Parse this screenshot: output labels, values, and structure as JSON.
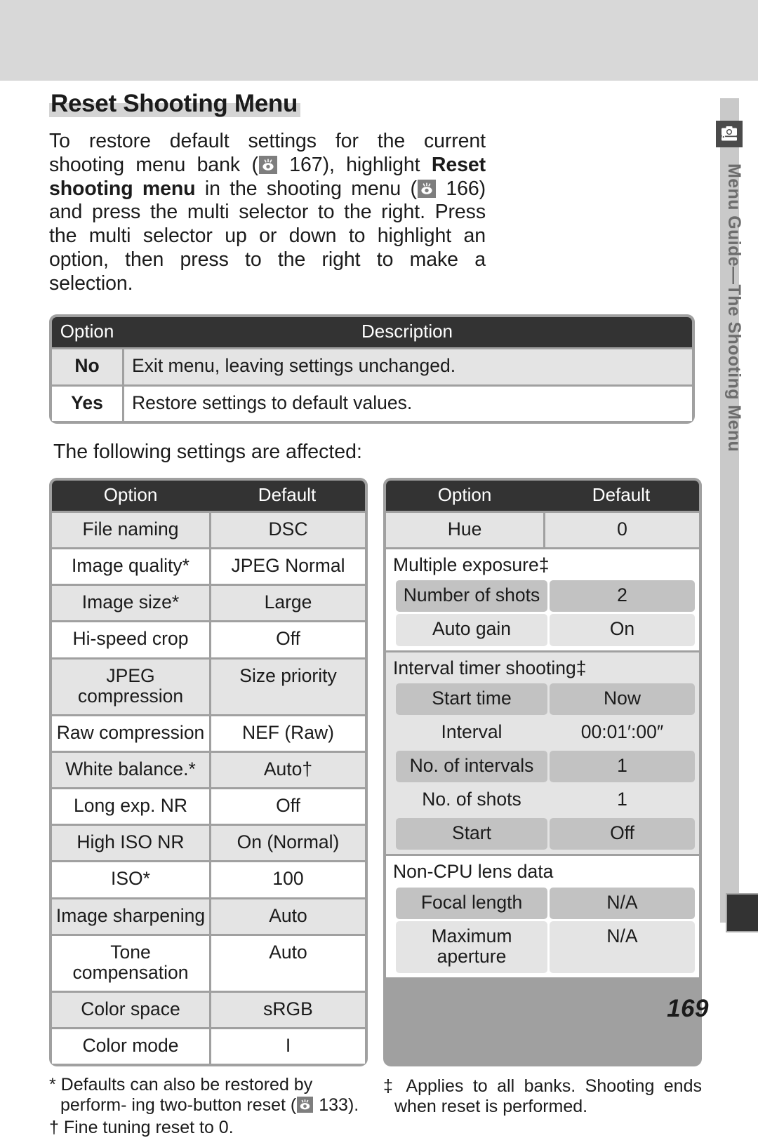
{
  "page": {
    "number": "169",
    "title": "Reset Shooting Menu"
  },
  "sidebar": {
    "label": "Menu Guide—The Shooting Menu",
    "icon": "camera-icon"
  },
  "intro": {
    "part1": "To restore default settings for the current shooting menu bank (",
    "ref1": "167",
    "part2": "), highlight ",
    "bold1": "Reset shooting menu",
    "part3": " in the shooting menu (",
    "ref2": "166",
    "part4": ") and press the multi selector to the right.  Press the multi selector up or down to highlight an option, then press to the right to make a selection."
  },
  "desc_table": {
    "headers": [
      "Option",
      "Description"
    ],
    "rows": [
      {
        "option": "No",
        "description": "Exit menu, leaving settings unchanged."
      },
      {
        "option": "Yes",
        "description": "Restore settings to default values."
      }
    ]
  },
  "affected_caption": "The following settings are affected:",
  "settings_left": {
    "headers": [
      "Option",
      "Default"
    ],
    "rows": [
      {
        "option": "File naming",
        "default": "DSC"
      },
      {
        "option": "Image quality*",
        "default": "JPEG Normal"
      },
      {
        "option": "Image size*",
        "default": "Large"
      },
      {
        "option": "Hi-speed crop",
        "default": "Off"
      },
      {
        "option": "JPEG compression",
        "default": "Size priority"
      },
      {
        "option": "Raw compression",
        "default": "NEF (Raw)"
      },
      {
        "option": "White balance.*",
        "default": "Auto†"
      },
      {
        "option": "Long exp. NR",
        "default": "Off"
      },
      {
        "option": "High ISO NR",
        "default": "On (Normal)"
      },
      {
        "option": "ISO*",
        "default": "100"
      },
      {
        "option": "Image sharpening",
        "default": "Auto"
      },
      {
        "option": "Tone compensation",
        "default": "Auto"
      },
      {
        "option": "Color space",
        "default": "sRGB"
      },
      {
        "option": "Color mode",
        "default": "I"
      }
    ]
  },
  "settings_right": {
    "headers": [
      "Option",
      "Default"
    ],
    "simple_row": {
      "option": "Hue",
      "default": "0"
    },
    "groups": [
      {
        "title": "Multiple exposure‡",
        "rows": [
          {
            "option": "Number of shots",
            "default": "2"
          },
          {
            "option": "Auto gain",
            "default": "On"
          }
        ]
      },
      {
        "title": "Interval timer shooting‡",
        "rows": [
          {
            "option": "Start time",
            "default": "Now"
          },
          {
            "option": "Interval",
            "default": "00:01′:00″"
          },
          {
            "option": "No. of intervals",
            "default": "1"
          },
          {
            "option": "No. of shots",
            "default": "1"
          },
          {
            "option": "Start",
            "default": "Off"
          }
        ]
      },
      {
        "title": "Non-CPU lens data",
        "rows": [
          {
            "option": "Focal length",
            "default": "N/A"
          },
          {
            "option": "Maximum aperture",
            "default": "N/A"
          }
        ]
      }
    ]
  },
  "footnotes": {
    "star_a": "* Defaults can also be restored by perform-",
    "star_b": "ing two-button reset (",
    "star_ref": "133",
    "star_c": ").",
    "dagger": "† Fine tuning reset to 0.",
    "dbldagger": "‡ Applies to all banks.  Shooting ends when reset is performed."
  },
  "colors": {
    "banner": "#d8d8d8",
    "header_dark": "#333333",
    "row_alt": "#e4e4e4",
    "sub_dark": "#c2c2c2",
    "frame": "#a0a0a0",
    "rail": "#c9c9c9"
  }
}
